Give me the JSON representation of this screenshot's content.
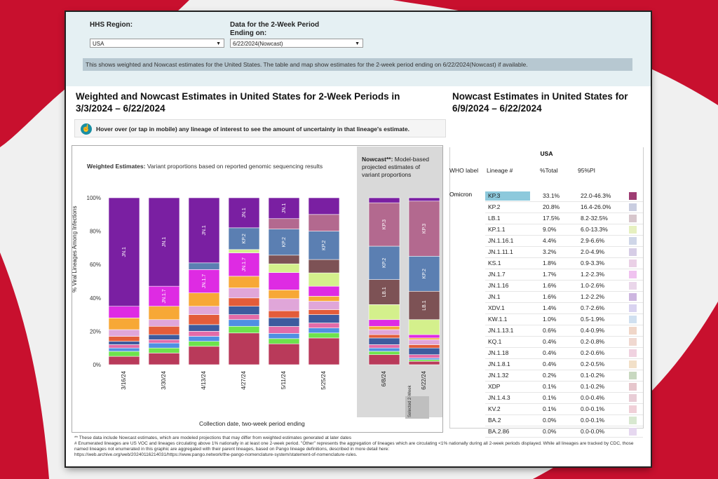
{
  "filters": {
    "region_label": "HHS Region:",
    "region_value": "USA",
    "period_label": "Data for the 2-Week Period Ending on:",
    "period_value": "6/22/2024(Nowcast)"
  },
  "info_text": "This shows weighted and Nowcast estimates for the United States. The table and map show estimates for the 2-week period ending on 6/22/2024(Nowcast) if available.",
  "left_heading": "Weighted and Nowcast Estimates in United States for 2-Week Periods in 3/3/2024 – 6/22/2024",
  "right_heading": "Nowcast Estimates in United States for 6/9/2024 – 6/22/2024",
  "hover_text": "Hover over (or tap in mobile) any lineage of interest to see the amount of uncertainty in that lineage's estimate.",
  "chart_title_bold": "Weighted Estimates:",
  "chart_title_rest": "Variant proportions based on reported genomic sequencing results",
  "nowcast_title_bold": "Nowcast**:",
  "nowcast_title_rest": "Model-based projected estimates of variant proportions",
  "selected_label": "Selected 2-Week",
  "footnote_1": "**    These data include Nowcast estimates, which are modeled projections that may differ from weighted estimates generated at later dates",
  "footnote_2": "# Enumerated lineages are US VOC and lineages circulating above 1% nationally in at least one 2-week period. \"Other\" represents the aggregation of lineages which are circulating <1% nationally during all 2-week periods displayed.  While all lineages are tracked by CDC, those named lineages not enumerated in this graphic are aggregated with their parent lineages, based on Pango lineage definitions, described in more detail here:",
  "footnote_3": "https://web.archive.org/web/20240116214031/https://www.pango.network/the-pango-nomenclature-system/statement-of-nomenclature-rules.",
  "table": {
    "region": "USA",
    "headers": [
      "WHO label",
      "Lineage #",
      "%Total",
      "95%PI"
    ],
    "who_label": "Omicron",
    "rows": [
      {
        "lineage": "KP.3",
        "total": "33.1%",
        "pi": "22.0-46.3%",
        "color": "#9e3d73"
      },
      {
        "lineage": "KP.2",
        "total": "20.8%",
        "pi": "16.4-26.0%",
        "color": "#c9cde0"
      },
      {
        "lineage": "LB.1",
        "total": "17.5%",
        "pi": "8.2-32.5%",
        "color": "#d7c6cc"
      },
      {
        "lineage": "KP.1.1",
        "total": "9.0%",
        "pi": "6.0-13.3%",
        "color": "#e6f0c0"
      },
      {
        "lineage": "JN.1.16.1",
        "total": "4.4%",
        "pi": "2.9-6.6%",
        "color": "#cfd6e8"
      },
      {
        "lineage": "JN.1.11.1",
        "total": "3.2%",
        "pi": "2.0-4.9%",
        "color": "#d6cde6"
      },
      {
        "lineage": "KS.1",
        "total": "1.8%",
        "pi": "0.9-3.3%",
        "color": "#ead0e6"
      },
      {
        "lineage": "JN.1.7",
        "total": "1.7%",
        "pi": "1.2-2.3%",
        "color": "#f0c2f0"
      },
      {
        "lineage": "JN.1.16",
        "total": "1.6%",
        "pi": "1.0-2.6%",
        "color": "#ead6ea"
      },
      {
        "lineage": "JN.1",
        "total": "1.6%",
        "pi": "1.2-2.2%",
        "color": "#cdb6e0"
      },
      {
        "lineage": "XDV.1",
        "total": "1.4%",
        "pi": "0.7-2.6%",
        "color": "#d9d3f0"
      },
      {
        "lineage": "KW.1.1",
        "total": "1.0%",
        "pi": "0.5-1.9%",
        "color": "#d0e0f0"
      },
      {
        "lineage": "JN.1.13.1",
        "total": "0.6%",
        "pi": "0.4-0.9%",
        "color": "#f0d6c8"
      },
      {
        "lineage": "KQ.1",
        "total": "0.4%",
        "pi": "0.2-0.8%",
        "color": "#f0d8d0"
      },
      {
        "lineage": "JN.1.18",
        "total": "0.4%",
        "pi": "0.2-0.6%",
        "color": "#f0d2e0"
      },
      {
        "lineage": "JN.1.8.1",
        "total": "0.4%",
        "pi": "0.2-0.5%",
        "color": "#f2e0c8"
      },
      {
        "lineage": "JN.1.32",
        "total": "0.2%",
        "pi": "0.1-0.2%",
        "color": "#c8d8c0"
      },
      {
        "lineage": "XDP",
        "total": "0.1%",
        "pi": "0.1-0.2%",
        "color": "#e6c6cc"
      },
      {
        "lineage": "JN.1.4.3",
        "total": "0.1%",
        "pi": "0.0-0.4%",
        "color": "#e8cdd6"
      },
      {
        "lineage": "KV.2",
        "total": "0.1%",
        "pi": "0.0-0.1%",
        "color": "#f0d0d8"
      },
      {
        "lineage": "BA.2",
        "total": "0.0%",
        "pi": "0.0-0.1%",
        "color": "#d8e8d0"
      },
      {
        "lineage": "BA.2.86",
        "total": "0.0%",
        "pi": "0.0-0.0%",
        "color": "#e6d8f0"
      }
    ]
  },
  "chart_data": {
    "type": "bar",
    "stacked": true,
    "ylabel": "% Viral Lineages Among Infections",
    "xlabel": "Collection date, two-week period ending",
    "ylim": [
      0,
      100
    ],
    "yticks": [
      "0%",
      "20%",
      "40%",
      "60%",
      "80%",
      "100%"
    ],
    "categories": [
      "3/16/24",
      "3/30/24",
      "4/13/24",
      "4/27/24",
      "5/11/24",
      "5/25/24",
      "6/8/24",
      "6/22/24"
    ],
    "nowcast_categories": [
      "6/8/24",
      "6/22/24"
    ],
    "selected_category": "6/22/24",
    "series": [
      {
        "name": "JN.1",
        "color": "#7a1fa2",
        "values": [
          65,
          53,
          39,
          18,
          12,
          10,
          3,
          2
        ]
      },
      {
        "name": "KP.3",
        "color": "#b3698f",
        "values": [
          0,
          0,
          0,
          0,
          6,
          10,
          26,
          33
        ]
      },
      {
        "name": "KP.2",
        "color": "#5b7fb2",
        "values": [
          0,
          0,
          4,
          13,
          15,
          17,
          20,
          21
        ]
      },
      {
        "name": "LB.1",
        "color": "#7d5255",
        "values": [
          0,
          0,
          0,
          0,
          5,
          8,
          15,
          17
        ]
      },
      {
        "name": "KP.1.1",
        "color": "#d4f08c",
        "values": [
          0,
          0,
          0,
          2,
          5,
          8,
          9,
          9
        ]
      },
      {
        "name": "JN.1.7",
        "color": "#de2be3",
        "values": [
          7,
          12,
          14,
          14,
          10,
          6,
          4,
          2
        ]
      },
      {
        "name": "JN.1.13.1",
        "color": "#f7a836",
        "values": [
          7,
          8,
          8,
          7,
          5,
          3,
          2,
          1
        ]
      },
      {
        "name": "JN.1.11.1",
        "color": "#e0a6d9",
        "values": [
          4,
          4,
          5,
          6,
          7,
          5,
          3,
          3
        ]
      },
      {
        "name": "JN.1.16",
        "color": "#e35c3a",
        "values": [
          3,
          5,
          6,
          5,
          4,
          3,
          2,
          2
        ]
      },
      {
        "name": "JN.1.16.1",
        "color": "#3d5b9e",
        "values": [
          2,
          3,
          4,
          5,
          5,
          5,
          4,
          4
        ]
      },
      {
        "name": "KS.1",
        "color": "#e36ba8",
        "values": [
          2,
          2,
          3,
          3,
          4,
          3,
          2,
          2
        ]
      },
      {
        "name": "XDV.1",
        "color": "#4f8fe3",
        "values": [
          2,
          3,
          3,
          4,
          3,
          3,
          2,
          1
        ]
      },
      {
        "name": "JN.1.18",
        "color": "#6de34c",
        "values": [
          3,
          3,
          3,
          4,
          3,
          3,
          2,
          1
        ]
      },
      {
        "name": "Other",
        "color": "#b93a5a",
        "values": [
          5,
          7,
          11,
          19,
          12,
          16,
          6,
          2
        ]
      }
    ]
  }
}
